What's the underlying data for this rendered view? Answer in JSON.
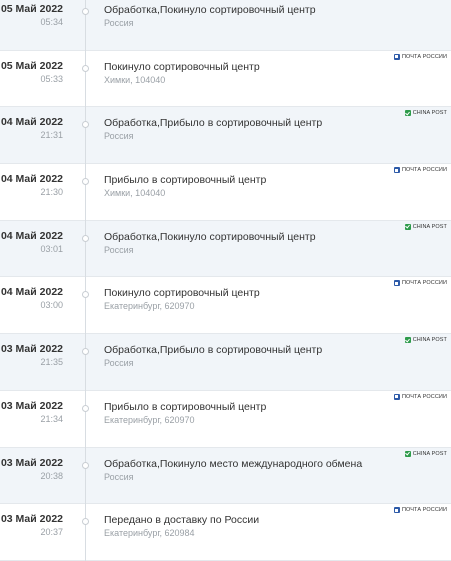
{
  "events": [
    {
      "date": "05 Май 2022",
      "time": "05:34",
      "status": "Обработка,Покинуло сортировочный центр",
      "place": "Россия",
      "carrier": "",
      "carrier_type": "none"
    },
    {
      "date": "05 Май 2022",
      "time": "05:33",
      "status": "Покинуло сортировочный центр",
      "place": "Химки, 104040",
      "carrier": "Почта России",
      "carrier_type": "pochta"
    },
    {
      "date": "04 Май 2022",
      "time": "21:31",
      "status": "Обработка,Прибыло в сортировочный центр",
      "place": "Россия",
      "carrier": "CHINA POST",
      "carrier_type": "china"
    },
    {
      "date": "04 Май 2022",
      "time": "21:30",
      "status": "Прибыло в сортировочный центр",
      "place": "Химки, 104040",
      "carrier": "Почта России",
      "carrier_type": "pochta"
    },
    {
      "date": "04 Май 2022",
      "time": "03:01",
      "status": "Обработка,Покинуло сортировочный центр",
      "place": "Россия",
      "carrier": "CHINA POST",
      "carrier_type": "china"
    },
    {
      "date": "04 Май 2022",
      "time": "03:00",
      "status": "Покинуло сортировочный центр",
      "place": "Екатеринбург, 620970",
      "carrier": "Почта России",
      "carrier_type": "pochta"
    },
    {
      "date": "03 Май 2022",
      "time": "21:35",
      "status": "Обработка,Прибыло в сортировочный центр",
      "place": "Россия",
      "carrier": "CHINA POST",
      "carrier_type": "china"
    },
    {
      "date": "03 Май 2022",
      "time": "21:34",
      "status": "Прибыло в сортировочный центр",
      "place": "Екатеринбург, 620970",
      "carrier": "Почта России",
      "carrier_type": "pochta"
    },
    {
      "date": "03 Май 2022",
      "time": "20:38",
      "status": "Обработка,Покинуло место международного обмена",
      "place": "Россия",
      "carrier": "CHINA POST",
      "carrier_type": "china"
    },
    {
      "date": "03 Май 2022",
      "time": "20:37",
      "status": "Передано в доставку по России",
      "place": "Екатеринбург, 620984",
      "carrier": "Почта России",
      "carrier_type": "pochta"
    }
  ],
  "colors": {
    "alt_row": "#f1f5f9",
    "pochta_logo": "#2d5aa8",
    "china_logo": "#2e9b4b"
  }
}
